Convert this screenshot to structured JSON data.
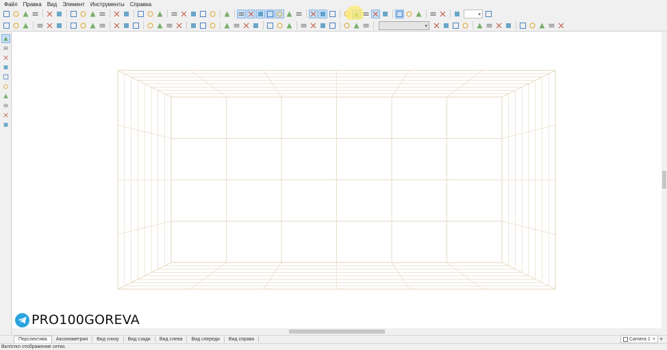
{
  "menu": [
    "Файл",
    "Правка",
    "Вид",
    "Элемент",
    "Инструменты",
    "Справка"
  ],
  "toolbar1": {
    "icons": [
      "new-file-icon",
      "open-file-icon",
      "save-icon",
      "save-as-icon",
      "print-icon",
      "print-preview-icon",
      "cut-icon",
      "copy-icon",
      "paste-icon",
      "delete-icon",
      "undo-icon",
      "redo-icon",
      "properties-icon",
      "calculator-icon",
      "dimensions-icon",
      "find-icon",
      "connect-icon",
      "materials-icon",
      "highlight-icon",
      "info-icon",
      "manual-icon",
      "view-front-icon",
      "view-top-icon",
      "view-side-icon",
      "view-3d-icon",
      "cube-icon",
      "cube-wire-icon",
      "cube-solid-icon",
      "grid-toggle-icon",
      "render-icon",
      "light-bulb-icon",
      "tag-icon",
      "measure-icon",
      "cursor-icon",
      "section-icon",
      "move-icon",
      "snap-icon",
      "snap-point-icon",
      "snap-edge-icon",
      "magnet-icon",
      "target-icon",
      "zoom-icon",
      "zoom-out-icon"
    ],
    "active": [
      "view-front-icon",
      "view-top-icon",
      "view-side-icon",
      "view-3d-icon",
      "cube-icon",
      "grid-toggle-icon",
      "render-icon",
      "measure-icon",
      "section-icon",
      "snap-icon"
    ]
  },
  "toolbar2": {
    "icons": [
      "align-left-icon",
      "align-center-h-icon",
      "align-right-icon",
      "align-top-icon",
      "align-middle-icon",
      "align-bottom-icon",
      "distribute-h-icon",
      "distribute-v-icon",
      "rotate-left-icon",
      "rotate-right-icon",
      "flip-h-icon",
      "flip-v-icon",
      "mirror-icon",
      "group-icon",
      "ungroup-icon",
      "lock-icon",
      "unlock-icon",
      "move-up-icon",
      "move-down-icon",
      "array-icon",
      "join-icon",
      "split-icon",
      "bevel-icon",
      "edge-icon",
      "panel-icon",
      "cut-panel-icon",
      "drill-icon",
      "fasten-icon",
      "hinge-icon",
      "handle-icon",
      "drawer-icon",
      "door-icon",
      "shelf-icon",
      "divider-icon",
      "grid-align-icon",
      "copy-format-icon",
      "rotate-3d-icon",
      "refresh-icon",
      "frame-icon",
      "transform-icon",
      "scale-icon",
      "cross-icon",
      "warning-icon",
      "ellipse-icon",
      "link-icon",
      "camera-icon",
      "settings-icon"
    ],
    "combo_value": ""
  },
  "left_tools": [
    "pointer-icon",
    "insert-icon",
    "panel-tool-icon",
    "line-tool-icon",
    "pencil-icon",
    "knife-icon",
    "section-tool-icon",
    "edge-tool-icon",
    "rotate-tool-icon",
    "measure-tool-icon"
  ],
  "watermark": {
    "text": "PRO100GOREVA",
    "icon": "telegram-icon"
  },
  "tabs": [
    "Перспектива",
    "Аксонометрия",
    "Вид снизу",
    "Вид сзади",
    "Вид слева",
    "Вид спереди",
    "Вид справа"
  ],
  "active_tab": "Перспектива",
  "camera": {
    "label": "Camera 1",
    "close": "×"
  },
  "status_text": "Вкл/откл отображение сетки.",
  "colors": {
    "grid": "#e6dcc8",
    "active_button": "#c9e0f7",
    "highlight": "#fff06e",
    "telegram": "#2aa3df"
  }
}
